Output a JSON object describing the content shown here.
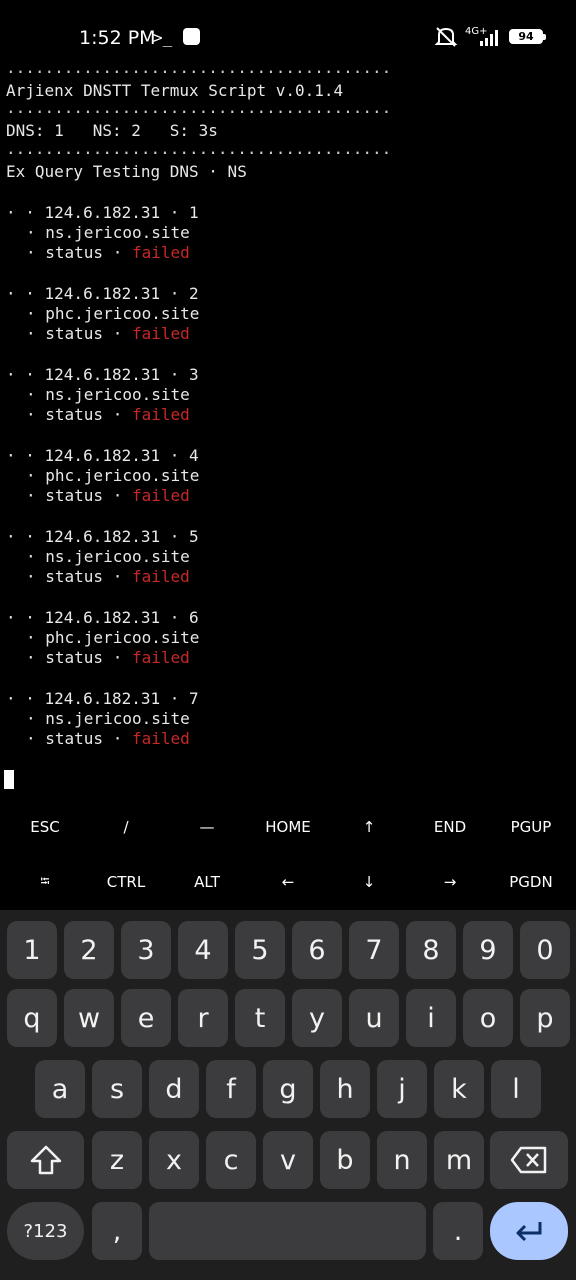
{
  "status_bar": {
    "time": "1:52 PM",
    "network": "4G+",
    "battery": "94"
  },
  "terminal": {
    "header_lines": [
      "Arjienx DNSTT Termux Script v.0.1.4",
      "DNS: 1   NS: 2   S: 3s",
      "Ex Query Testing DNS · NS"
    ],
    "dots": "........................................",
    "entries": [
      {
        "line": "· · 124.6.182.31 · 1",
        "host": "· ns.jericoo.site",
        "status_label": "· status · ",
        "status": "failed"
      },
      {
        "line": "· · 124.6.182.31 · 2",
        "host": "· phc.jericoo.site",
        "status_label": "· status · ",
        "status": "failed"
      },
      {
        "line": "· · 124.6.182.31 · 3",
        "host": "· ns.jericoo.site",
        "status_label": "· status · ",
        "status": "failed"
      },
      {
        "line": "· · 124.6.182.31 · 4",
        "host": "· phc.jericoo.site",
        "status_label": "· status · ",
        "status": "failed"
      },
      {
        "line": "· · 124.6.182.31 · 5",
        "host": "· ns.jericoo.site",
        "status_label": "· status · ",
        "status": "failed"
      },
      {
        "line": "· · 124.6.182.31 · 6",
        "host": "· phc.jericoo.site",
        "status_label": "· status · ",
        "status": "failed"
      },
      {
        "line": "· · 124.6.182.31 · 7",
        "host": "· ns.jericoo.site",
        "status_label": "· status · ",
        "status": "failed"
      }
    ]
  },
  "extra_keys": {
    "row1": [
      "ESC",
      "/",
      "—",
      "HOME",
      "↑",
      "END",
      "PGUP"
    ],
    "row2": [
      "⭾",
      "CTRL",
      "ALT",
      "←",
      "↓",
      "→",
      "PGDN"
    ]
  },
  "keyboard": {
    "numbers": [
      "1",
      "2",
      "3",
      "4",
      "5",
      "6",
      "7",
      "8",
      "9",
      "0"
    ],
    "row_q": [
      "q",
      "w",
      "e",
      "r",
      "t",
      "y",
      "u",
      "i",
      "o",
      "p"
    ],
    "row_a": [
      "a",
      "s",
      "d",
      "f",
      "g",
      "h",
      "j",
      "k",
      "l"
    ],
    "row_z": [
      "z",
      "x",
      "c",
      "v",
      "b",
      "n",
      "m"
    ],
    "symbols_label": "?123",
    "comma": ",",
    "period": "."
  },
  "icons": {
    "shift": "shift-icon",
    "backspace": "backspace-icon",
    "enter": "enter-icon"
  }
}
